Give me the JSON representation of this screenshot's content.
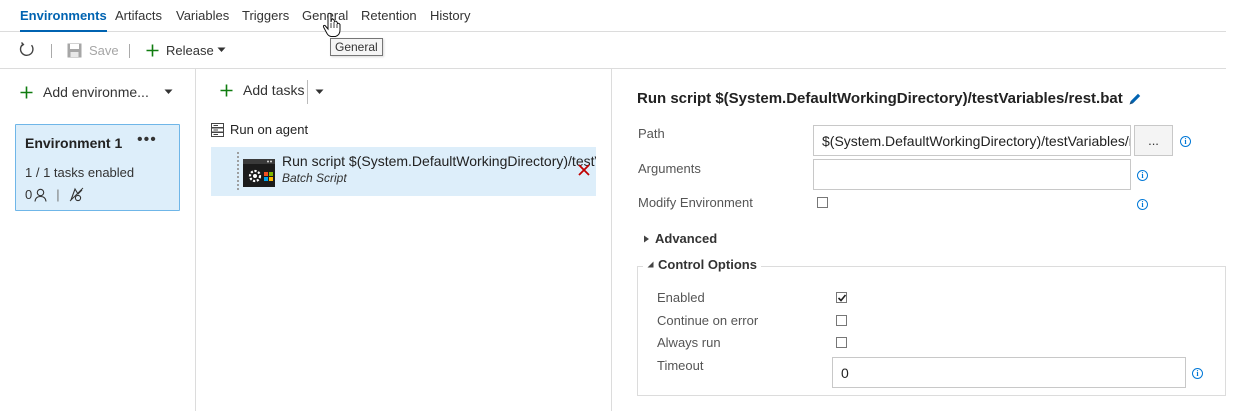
{
  "tabs": [
    {
      "label": "Environments",
      "active": true
    },
    {
      "label": "Artifacts"
    },
    {
      "label": "Variables"
    },
    {
      "label": "Triggers"
    },
    {
      "label": "General"
    },
    {
      "label": "Retention"
    },
    {
      "label": "History"
    }
  ],
  "tooltip": {
    "text": "General"
  },
  "toolbar": {
    "save_label": "Save",
    "release_label": "Release"
  },
  "environments_pane": {
    "add_label": "Add environme...",
    "card": {
      "title": "Environment 1",
      "status": "1 / 1 tasks enabled",
      "approver_count": "0",
      "more_label": "•••"
    }
  },
  "tasks_pane": {
    "add_label": "Add tasks",
    "phase_label": "Run on agent",
    "task": {
      "title": "Run script $(System.DefaultWorkingDirectory)/testVariables/rest.bat",
      "subtitle": "Batch Script"
    }
  },
  "details": {
    "title": "Run script $(System.DefaultWorkingDirectory)/testVariables/rest.bat",
    "path_label": "Path",
    "path_value": "$(System.DefaultWorkingDirectory)/testVariables/rest.bat",
    "browse_label": "...",
    "arguments_label": "Arguments",
    "arguments_value": "",
    "modify_env_label": "Modify Environment",
    "modify_env_checked": false,
    "advanced_label": "Advanced",
    "control_options_label": "Control Options",
    "enabled_label": "Enabled",
    "enabled_checked": true,
    "continue_label": "Continue on error",
    "continue_checked": false,
    "always_label": "Always run",
    "always_checked": false,
    "timeout_label": "Timeout",
    "timeout_value": "0"
  },
  "colors": {
    "accent": "#0063b1",
    "selected_bg": "#ddeefa",
    "add_green": "#107c10",
    "delete_red": "#c00000"
  }
}
